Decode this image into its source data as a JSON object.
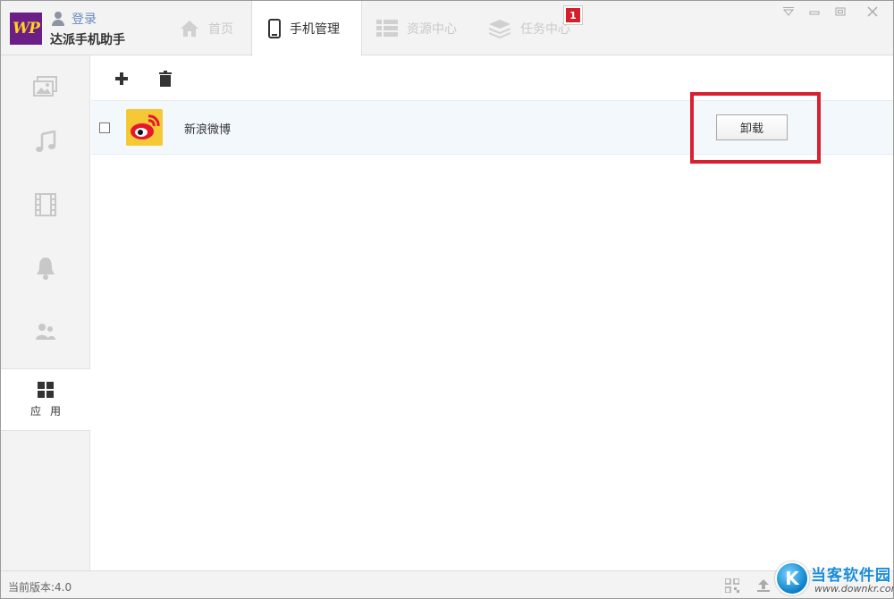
{
  "header": {
    "logo_text": "WP",
    "login_label": "登录",
    "app_name": "达派手机助手",
    "tabs": [
      {
        "label": "首页",
        "icon": "home-icon"
      },
      {
        "label": "手机管理",
        "icon": "phone-icon",
        "active": true
      },
      {
        "label": "资源中心",
        "icon": "grid-list-icon"
      },
      {
        "label": "任务中心",
        "icon": "layers-icon"
      }
    ],
    "task_badge": "1"
  },
  "sidebar": {
    "items": [
      {
        "icon": "photo-icon"
      },
      {
        "icon": "music-icon"
      },
      {
        "icon": "video-icon"
      },
      {
        "icon": "ringtone-icon"
      },
      {
        "icon": "contacts-icon"
      },
      {
        "icon": "apps-icon",
        "label": "应用",
        "active": true
      }
    ]
  },
  "toolbar": {
    "add_icon": "plus-icon",
    "delete_icon": "trash-icon"
  },
  "apps": [
    {
      "name": "新浪微博",
      "action_label": "卸载",
      "icon": "weibo-icon",
      "checked": false
    }
  ],
  "status": {
    "version": "当前版本:4.0"
  },
  "watermark": {
    "logo_letter": "K",
    "title": "当客软件园",
    "url": "www.downkr.com"
  },
  "colors": {
    "brand_purple": "#6b1e86",
    "badge_red": "#d2202c",
    "highlight_red": "#d9202e",
    "weibo_yellow": "#f5c935"
  }
}
